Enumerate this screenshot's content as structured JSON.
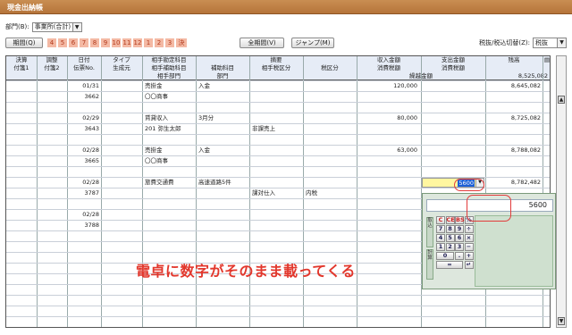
{
  "window_title": "現金出納帳",
  "department": {
    "label": "部門(B):",
    "value": "事業所(合計)"
  },
  "toolbar": {
    "period_label": "期間(Q)",
    "months": [
      "4",
      "5",
      "6",
      "7",
      "8",
      "9",
      "10",
      "11",
      "12",
      "1",
      "2",
      "3",
      "決"
    ],
    "all_period_label": "全期間(V)",
    "jump_label": "ジャンプ(M)",
    "tax_label": "税抜/税込切替(Z):",
    "tax_value": "税抜"
  },
  "columns": {
    "kessan": "決算",
    "fusen1": "付箋1",
    "chosei": "調整",
    "fusen2": "付箋2",
    "hizuke": "日付",
    "denpyo": "伝票No.",
    "type": "タイプ",
    "seiseimoto": "生成元",
    "aite_kamoku": "相手勘定科目",
    "aite_hojo": "相手補助科目",
    "aite_bumon": "相手部門",
    "tekiyo": "摘要",
    "hojo_kamoku": "補助科目",
    "bumon": "部門",
    "aite_zei": "相手税区分",
    "zei": "税区分",
    "shunyu": "収入金額",
    "shohizei1": "消費税額",
    "shishutsu": "支出金額",
    "shohizei2": "消費税額",
    "kurikoshi": "繰越金額",
    "zandaka": "残高"
  },
  "carry_balance": "8,525,082",
  "rows": [
    {
      "date": "01/31",
      "denpyo": "3662",
      "account": "売掛金",
      "partner": "〇〇商事",
      "memo": "入金",
      "memo2": "",
      "tax": "",
      "taxcls": "",
      "income": "120,000",
      "expense": "",
      "balance": "8,645,082"
    },
    {
      "date": "02/29",
      "denpyo": "3643",
      "account": "賃貸収入",
      "partner": "201 弥生太郎",
      "memo": "3月分",
      "memo2": "",
      "tax": "非課売上",
      "taxcls": "",
      "income": "80,000",
      "expense": "",
      "balance": "8,725,082"
    },
    {
      "date": "02/28",
      "denpyo": "3665",
      "account": "売掛金",
      "partner": "〇〇商事",
      "memo": "入金",
      "memo2": "",
      "tax": "",
      "taxcls": "",
      "income": "63,000",
      "expense": "",
      "balance": "8,788,082"
    },
    {
      "date": "02/28",
      "denpyo": "3787",
      "account": "旅費交通費",
      "partner": "",
      "memo": "高速道路5件",
      "memo2": "",
      "tax": "課対仕入",
      "taxcls": "内税",
      "income": "",
      "expense": "5600",
      "balance": "8,782,482"
    },
    {
      "date": "02/28",
      "denpyo": "3788",
      "account": "",
      "partner": "",
      "memo": "",
      "memo2": "",
      "tax": "",
      "taxcls": "",
      "income": "",
      "expense": "",
      "balance": ""
    }
  ],
  "calculator": {
    "display": "5600",
    "side_top": "取込",
    "side_bottom": "計算",
    "keys": [
      [
        "C",
        "CE",
        "BS",
        "%"
      ],
      [
        "7",
        "8",
        "9",
        "÷"
      ],
      [
        "4",
        "5",
        "6",
        "×"
      ],
      [
        "1",
        "2",
        "3",
        "−"
      ],
      [
        "0",
        ".",
        "+"
      ],
      [
        "=",
        "↵"
      ]
    ]
  },
  "caption": "電卓に数字がそのまま載ってくる",
  "colors": {
    "title_bar": "#b5743a",
    "month_chip": "#f4b9a4",
    "header_bg": "#e6ecf6",
    "caption": "#e2372c",
    "highlight": "#fff6a0"
  }
}
